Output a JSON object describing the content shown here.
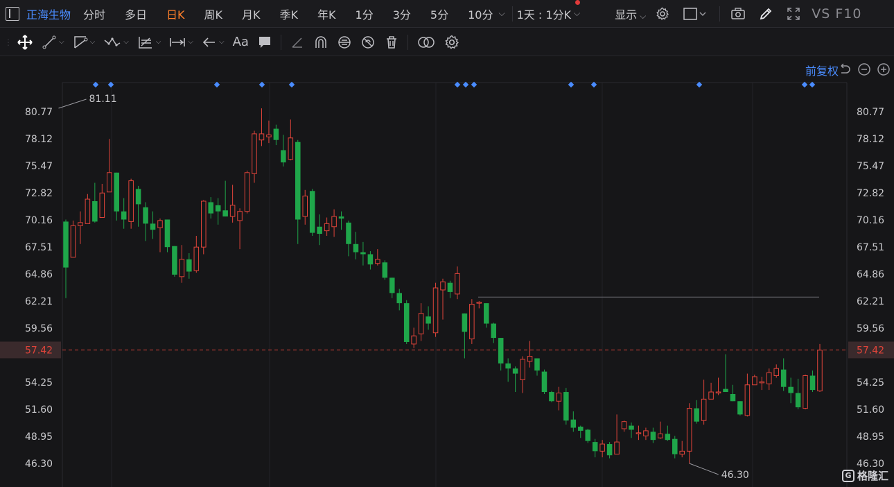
{
  "header": {
    "stock_name": "正海生物",
    "periods": [
      "分时",
      "多日",
      "日K",
      "周K",
      "月K",
      "季K",
      "年K",
      "1分",
      "3分",
      "5分",
      "10分"
    ],
    "active_period": "日K",
    "interval": "1天 : 1分K",
    "display_label": "显示",
    "vs_f10": "VS F10"
  },
  "chart": {
    "price_adjust_label": "前复权",
    "watermark": "格隆汇",
    "current_price_label": "57.42",
    "high_label": "81.11",
    "low_label": "46.30",
    "y_ticks": [
      "80.77",
      "78.12",
      "75.47",
      "72.82",
      "70.16",
      "67.51",
      "64.86",
      "62.21",
      "59.56",
      "57.42",
      "54.25",
      "51.60",
      "48.95",
      "46.30"
    ],
    "colors": {
      "up": "#e0443a",
      "down": "#1fa64a",
      "accent": "#4a8cff",
      "active": "#ff7f2a",
      "current": "#e0443a"
    }
  },
  "chart_data": {
    "type": "candlestick",
    "ylim": [
      46.3,
      81.11
    ],
    "current": 57.42,
    "high": 81.11,
    "low": 46.3,
    "candles": [
      [
        70.0,
        65.5,
        70.2,
        62.5
      ],
      [
        66.5,
        69.6,
        70.1,
        66.5
      ],
      [
        69.6,
        69.9,
        71.0,
        67.8
      ],
      [
        69.8,
        72.2,
        72.7,
        69.8
      ],
      [
        72.0,
        70.0,
        73.8,
        69.9
      ],
      [
        70.4,
        72.8,
        73.7,
        70.4
      ],
      [
        72.9,
        74.8,
        78.1,
        72.9
      ],
      [
        74.8,
        71.0,
        74.8,
        70.1
      ],
      [
        71.0,
        70.2,
        72.3,
        69.3
      ],
      [
        70.0,
        74.0,
        74.2,
        69.3
      ],
      [
        73.2,
        71.7,
        73.5,
        69.5
      ],
      [
        71.4,
        69.8,
        71.9,
        68.1
      ],
      [
        69.8,
        69.2,
        71.0,
        68.3
      ],
      [
        69.4,
        70.1,
        70.3,
        67.0
      ],
      [
        70.2,
        67.5,
        70.2,
        67.0
      ],
      [
        67.6,
        64.8,
        67.6,
        64.6
      ],
      [
        64.6,
        66.3,
        67.7,
        64.0
      ],
      [
        66.3,
        65.1,
        66.9,
        64.4
      ],
      [
        65.2,
        67.5,
        68.6,
        65.0
      ],
      [
        67.5,
        72.0,
        72.1,
        66.8
      ],
      [
        71.9,
        70.8,
        72.4,
        70.3
      ],
      [
        71.6,
        71.0,
        72.3,
        69.7
      ],
      [
        71.1,
        70.5,
        74.0,
        70.5
      ],
      [
        70.5,
        71.6,
        73.6,
        69.9
      ],
      [
        70.1,
        71.0,
        71.3,
        67.3
      ],
      [
        71.0,
        74.8,
        75.0,
        70.8
      ],
      [
        74.7,
        78.6,
        78.9,
        73.8
      ],
      [
        78.0,
        78.6,
        81.1,
        77.4
      ],
      [
        78.3,
        78.5,
        79.9,
        77.7
      ],
      [
        79.1,
        78.0,
        79.5,
        77.5
      ],
      [
        77.0,
        75.8,
        78.5,
        75.4
      ],
      [
        76.1,
        78.2,
        80.0,
        76.0
      ],
      [
        77.8,
        70.2,
        78.0,
        67.8
      ],
      [
        70.5,
        72.5,
        73.1,
        69.7
      ],
      [
        73.0,
        68.9,
        73.2,
        68.6
      ],
      [
        69.5,
        68.8,
        70.7,
        67.7
      ],
      [
        69.1,
        69.8,
        70.4,
        68.6
      ],
      [
        69.5,
        70.5,
        71.2,
        68.5
      ],
      [
        70.5,
        70.3,
        71.0,
        69.2
      ],
      [
        69.9,
        67.8,
        70.1,
        66.6
      ],
      [
        67.8,
        67.0,
        69.0,
        66.3
      ],
      [
        67.0,
        66.8,
        68.0,
        65.7
      ],
      [
        66.8,
        65.8,
        67.1,
        65.3
      ],
      [
        65.9,
        66.3,
        67.3,
        65.7
      ],
      [
        66.0,
        64.5,
        66.2,
        64.3
      ],
      [
        64.5,
        63.0,
        64.5,
        62.5
      ],
      [
        63.0,
        62.0,
        63.4,
        61.3
      ],
      [
        62.0,
        58.2,
        62.3,
        58.0
      ],
      [
        58.0,
        58.8,
        59.6,
        57.6
      ],
      [
        59.0,
        61.0,
        62.0,
        58.3
      ],
      [
        60.7,
        60.0,
        61.7,
        59.4
      ],
      [
        59.1,
        63.5,
        64.0,
        58.7
      ],
      [
        63.3,
        64.1,
        64.4,
        60.4
      ],
      [
        64.0,
        63.1,
        64.2,
        62.5
      ],
      [
        62.9,
        64.9,
        65.6,
        62.4
      ],
      [
        61.0,
        59.2,
        61.0,
        56.6
      ],
      [
        58.5,
        61.9,
        62.4,
        58.0
      ],
      [
        62.0,
        62.1,
        62.2,
        61.5
      ],
      [
        62.0,
        60.0,
        62.0,
        59.6
      ],
      [
        60.0,
        58.6,
        60.1,
        58.1
      ],
      [
        58.6,
        56.1,
        58.6,
        55.4
      ],
      [
        56.1,
        55.6,
        56.6,
        54.3
      ],
      [
        55.6,
        55.1,
        55.8,
        53.3
      ],
      [
        54.5,
        56.5,
        56.8,
        53.2
      ],
      [
        56.3,
        56.8,
        58.3,
        55.7
      ],
      [
        56.6,
        55.4,
        56.6,
        54.9
      ],
      [
        55.3,
        53.3,
        55.5,
        53.1
      ],
      [
        53.3,
        52.4,
        53.4,
        52.3
      ],
      [
        52.4,
        53.2,
        53.8,
        51.5
      ],
      [
        53.3,
        50.5,
        53.7,
        50.1
      ],
      [
        50.6,
        49.8,
        51.4,
        49.4
      ],
      [
        49.9,
        49.5,
        50.0,
        48.8
      ],
      [
        49.6,
        48.5,
        49.7,
        48.3
      ],
      [
        48.4,
        47.5,
        48.7,
        46.9
      ],
      [
        47.5,
        48.2,
        48.6,
        46.9
      ],
      [
        48.2,
        47.1,
        48.4,
        46.8
      ],
      [
        47.2,
        48.4,
        51.1,
        47.8
      ],
      [
        49.7,
        50.4,
        50.5,
        49.4
      ],
      [
        50.0,
        49.6,
        50.3,
        48.8
      ],
      [
        49.3,
        49.3,
        50.0,
        48.6
      ],
      [
        49.0,
        49.5,
        49.8,
        48.6
      ],
      [
        49.4,
        48.6,
        49.8,
        48.3
      ],
      [
        48.8,
        49.2,
        50.4,
        48.7
      ],
      [
        49.2,
        48.6,
        50.0,
        48.5
      ],
      [
        48.7,
        47.2,
        49.0,
        46.8
      ],
      [
        47.2,
        47.5,
        48.5,
        46.9
      ],
      [
        47.5,
        51.7,
        52.2,
        46.3
      ],
      [
        51.7,
        50.4,
        52.5,
        50.2
      ],
      [
        50.5,
        52.6,
        54.5,
        50.1
      ],
      [
        52.6,
        53.3,
        54.2,
        52.6
      ],
      [
        53.3,
        53.3,
        54.7,
        53.0
      ],
      [
        53.6,
        53.3,
        57.0,
        53.3
      ],
      [
        53.1,
        52.4,
        54.0,
        52.4
      ],
      [
        52.4,
        51.1,
        52.4,
        51.0
      ],
      [
        51.0,
        54.0,
        55.1,
        50.9
      ],
      [
        54.0,
        54.8,
        55.0,
        54.0
      ],
      [
        54.3,
        54.3,
        54.8,
        53.5
      ],
      [
        54.1,
        55.2,
        55.6,
        53.5
      ],
      [
        54.9,
        55.6,
        56.0,
        54.7
      ],
      [
        55.5,
        53.8,
        56.6,
        53.4
      ],
      [
        53.8,
        53.2,
        54.7,
        52.2
      ],
      [
        53.2,
        51.8,
        54.6,
        51.6
      ],
      [
        51.7,
        54.9,
        55.0,
        51.6
      ],
      [
        54.9,
        53.5,
        55.4,
        53.3
      ],
      [
        53.4,
        57.4,
        58.0,
        53.3
      ]
    ]
  }
}
